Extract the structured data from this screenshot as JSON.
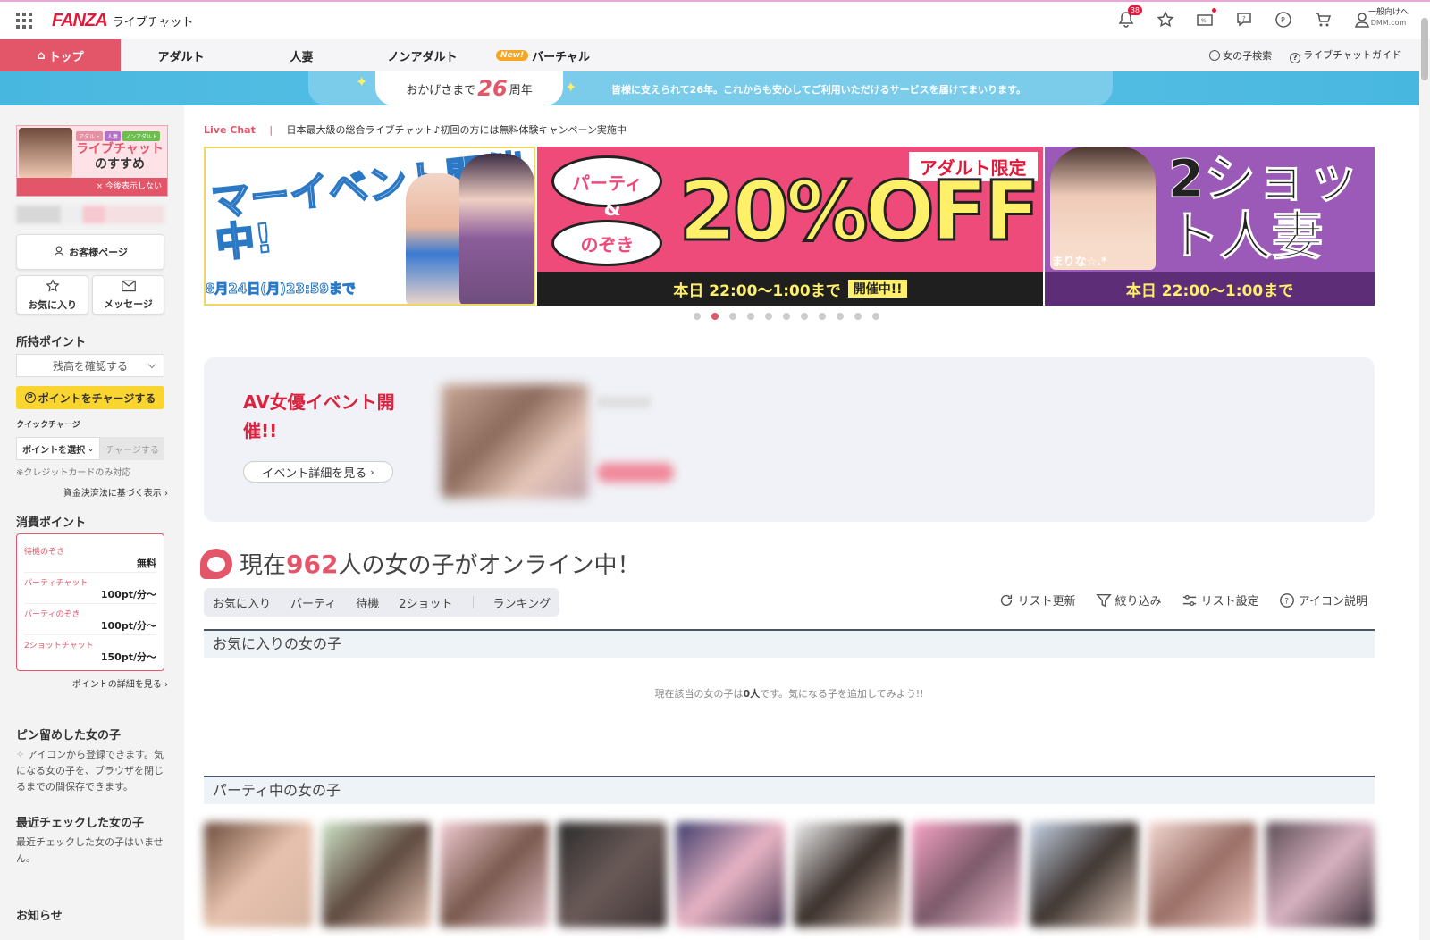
{
  "header": {
    "logo_main": "FANZA",
    "logo_sub": "ライブチャット",
    "notification_count": "38",
    "general_link": "一般向けへ",
    "general_sub": "DMM.com"
  },
  "nav": {
    "tabs": [
      {
        "label": "トップ"
      },
      {
        "label": "アダルト"
      },
      {
        "label": "人妻"
      },
      {
        "label": "ノンアダルト"
      },
      {
        "label": "バーチャル",
        "new": "New!"
      }
    ],
    "search_girls": "女の子検索",
    "guide": "ライブチャットガイド"
  },
  "anniversary": {
    "prefix": "おかげさまで",
    "years": "26",
    "suffix": "周年",
    "message": "皆様に支えられて26年。これからも安心してご利用いただけるサービスを届けてまいります。"
  },
  "sidebar": {
    "promo": {
      "tags": [
        "アダルト",
        "人妻",
        "ノンアダルト"
      ],
      "title_line1": "ライブチャット",
      "title_line2": "のすすめ",
      "close": "× 今後表示しない"
    },
    "customer_page": "お客様ページ",
    "favorites": "お気に入り",
    "messages": "メッセージ",
    "points_heading": "所持ポイント",
    "balance_select": "残高を確認する",
    "charge_button": "ポイントをチャージする",
    "quick_charge_label": "クイックチャージ",
    "quick_select": "ポイントを選択",
    "quick_charge_button": "チャージする",
    "credit_note": "※クレジットカードのみ対応",
    "payment_link": "資金決済法に基づく表示",
    "consume_heading": "消費ポイント",
    "consume_rows": [
      {
        "name": "待機のぞき",
        "value": "無料"
      },
      {
        "name": "パーティチャット",
        "value": "100pt/分〜"
      },
      {
        "name": "パーティのぞき",
        "value": "100pt/分〜"
      },
      {
        "name": "2ショットチャット",
        "value": "150pt/分〜"
      }
    ],
    "points_detail_link": "ポイントの詳細を見る",
    "pinned_heading": "ピン留めした女の子",
    "pinned_text": "アイコンから登録できます。気になる女の子を、ブラウザを閉じるまでの間保存できます。",
    "recent_heading": "最近チェックした女の子",
    "recent_text": "最近チェックした女の子はいません。",
    "news_heading": "お知らせ"
  },
  "main": {
    "livechat_label": "Live Chat",
    "livechat_separator": "|",
    "livechat_text": "日本最大級の総合ライブチャット♪初回の方には無料体験キャンペーン実施中",
    "banner1": {
      "title": "マーイベント開催中!",
      "date": "8月24日(月)23:59まで"
    },
    "banner2": {
      "limit": "アダルト限定",
      "bubble1": "パーティ",
      "amp": "&",
      "bubble2": "のぞき",
      "off": "20%OFF",
      "time": "本日 22:00〜1:00まで",
      "status": "開催中!!"
    },
    "banner3": {
      "name": "まりな☆.*",
      "big": "2ショット人妻",
      "time": "本日 22:00〜1:00まで"
    },
    "carousel_dots": 11,
    "carousel_active": 1,
    "event_title": "AV女優イベント開催!!",
    "event_link": "イベント詳細を見る",
    "online_prefix": "現在",
    "online_count": "962",
    "online_suffix": "人の女の子がオンライン中！",
    "filter_tabs": [
      "お気に入り",
      "パーティ",
      "待機",
      "2ショット",
      "ランキング"
    ],
    "tools": [
      "リスト更新",
      "絞り込み",
      "リスト設定",
      "アイコン説明"
    ],
    "favorites_section": "お気に入りの女の子",
    "empty_message_pre": "現在該当の女の子は",
    "empty_count": "0人",
    "empty_message_post": "です。気になる子を追加してみよう!!",
    "party_section": "パーティ中の女の子"
  },
  "colors": {
    "accent": "#e3566a",
    "brand_red": "#e3193b",
    "charge_yellow": "#fbd52f",
    "anniv_blue": "#48b7df"
  }
}
